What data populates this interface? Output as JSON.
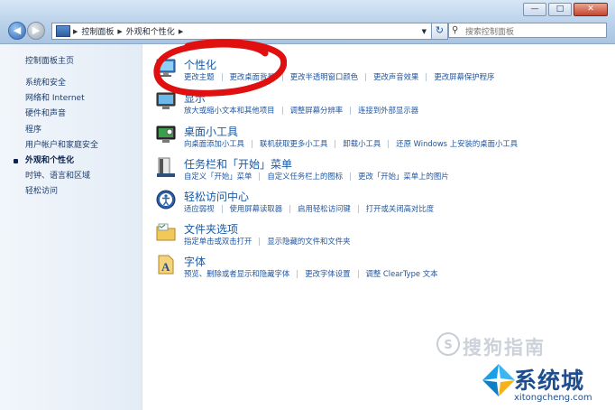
{
  "window_controls": {
    "minimize": "—",
    "maximize": "□",
    "close": "✕"
  },
  "nav": {
    "back_icon": "arrow-left-icon",
    "forward_icon": "arrow-right-icon"
  },
  "address": {
    "breadcrumb": [
      "控制面板",
      "外观和个性化"
    ],
    "separator": "▶",
    "dropdown": "▼"
  },
  "refresh_glyph": "↻",
  "search": {
    "placeholder": "搜索控制面板",
    "icon_glyph": "⚲"
  },
  "sidebar": {
    "home": "控制面板主页",
    "items": [
      {
        "label": "系统和安全"
      },
      {
        "label": "网络和 Internet"
      },
      {
        "label": "硬件和声音"
      },
      {
        "label": "程序"
      },
      {
        "label": "用户帐户和家庭安全"
      },
      {
        "label": "外观和个性化"
      },
      {
        "label": "时钟、语言和区域"
      },
      {
        "label": "轻松访问"
      }
    ],
    "active_index": 5
  },
  "categories": [
    {
      "id": "personalization",
      "title": "个性化",
      "icon": "personalization-icon",
      "links": [
        "更改主题",
        "更改桌面背景",
        "更改半透明窗口颜色",
        "更改声音效果",
        "更改屏幕保护程序"
      ]
    },
    {
      "id": "display",
      "title": "显示",
      "icon": "display-icon",
      "links": [
        "放大或缩小文本和其他项目",
        "调整屏幕分辨率",
        "连接到外部显示器"
      ]
    },
    {
      "id": "desktop-gadgets",
      "title": "桌面小工具",
      "icon": "gadgets-icon",
      "links": [
        "向桌面添加小工具",
        "联机获取更多小工具",
        "卸载小工具",
        "还原 Windows 上安装的桌面小工具"
      ]
    },
    {
      "id": "taskbar",
      "title": "任务栏和「开始」菜单",
      "icon": "taskbar-icon",
      "links": [
        "自定义「开始」菜单",
        "自定义任务栏上的图标",
        "更改「开始」菜单上的图片"
      ]
    },
    {
      "id": "ease-of-access",
      "title": "轻松访问中心",
      "icon": "ease-of-access-icon",
      "links": [
        "适应弱视",
        "使用屏幕读取器",
        "启用轻松访问键",
        "打开或关闭高对比度"
      ]
    },
    {
      "id": "folder-options",
      "title": "文件夹选项",
      "icon": "folder-icon",
      "links": [
        "指定单击或双击打开",
        "显示隐藏的文件和文件夹"
      ]
    },
    {
      "id": "fonts",
      "title": "字体",
      "icon": "fonts-icon",
      "links": [
        "预览、删除或者显示和隐藏字体",
        "更改字体设置",
        "调整 ClearType 文本"
      ]
    }
  ],
  "watermarks": {
    "sogou_text": "搜狗指南",
    "sogou_mark": "S",
    "site_name": "系统城",
    "site_domain": "xitongcheng.com"
  },
  "colors": {
    "link": "#1f56a3",
    "title": "#1c5aa3",
    "annotation": "#e01010"
  }
}
